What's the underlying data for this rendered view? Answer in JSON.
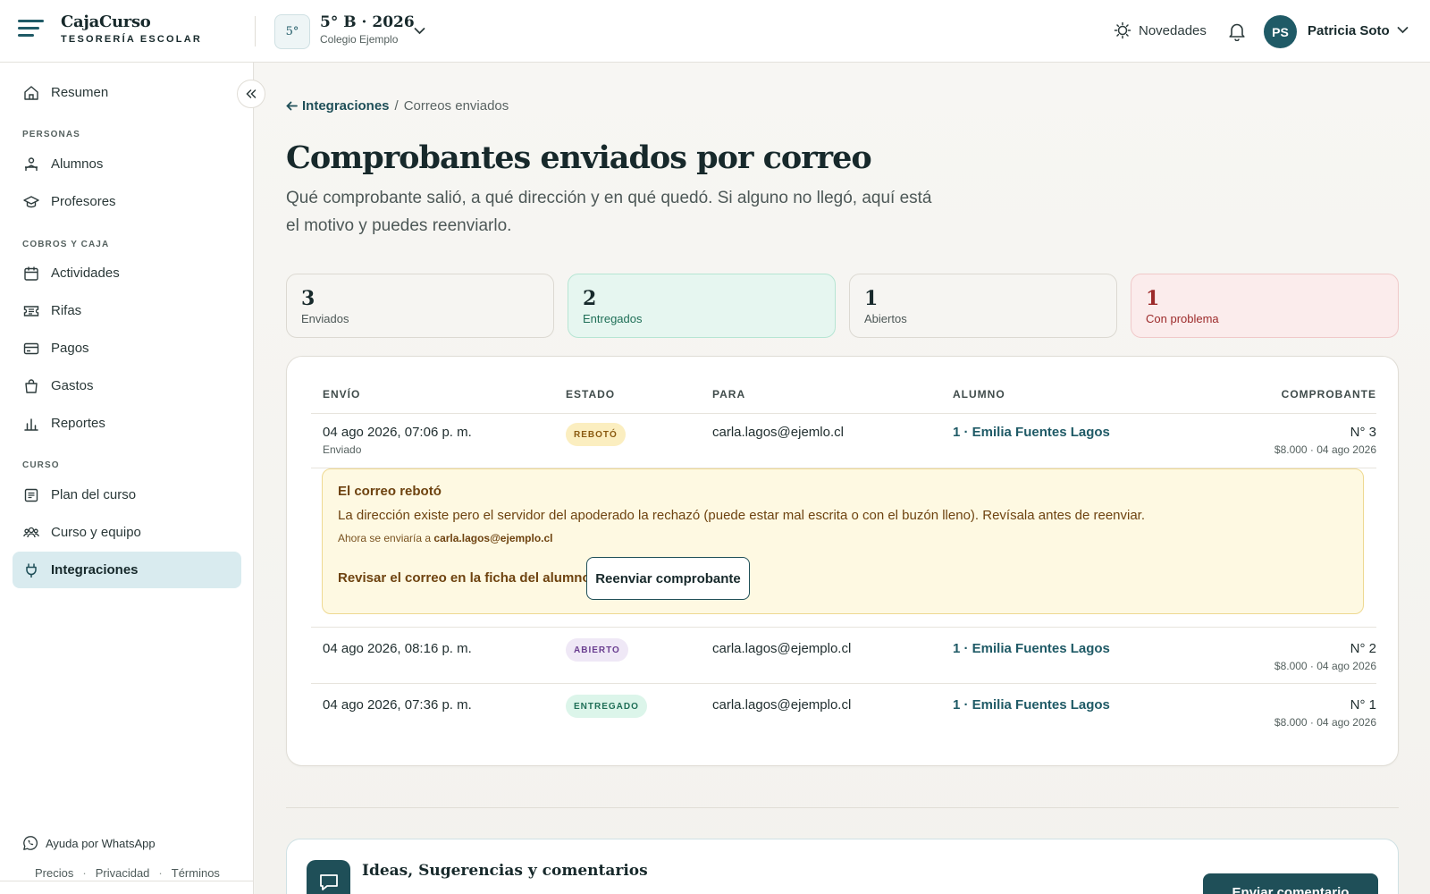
{
  "header": {
    "brand_name": "CajaCurso",
    "brand_sub": "TESORERÍA ESCOLAR",
    "course_badge": "5°",
    "course_title": "5° B · 2026",
    "course_school": "Colegio Ejemplo",
    "news_label": "Novedades",
    "user_initials": "PS",
    "user_name": "Patricia Soto"
  },
  "sidebar": {
    "summary": "Resumen",
    "section_people": "PERSONAS",
    "students": "Alumnos",
    "teachers": "Profesores",
    "section_billing": "COBROS Y CAJA",
    "activities": "Actividades",
    "raffles": "Rifas",
    "payments": "Pagos",
    "expenses": "Gastos",
    "reports": "Reportes",
    "section_course": "CURSO",
    "plan": "Plan del curso",
    "team": "Curso y equipo",
    "integrations": "Integraciones",
    "whatsapp": "Ayuda por WhatsApp",
    "footer": [
      "Precios",
      "Privacidad",
      "Términos"
    ]
  },
  "breadcrumb": {
    "back_label": "Integraciones",
    "separator": "/",
    "current": "Correos enviados"
  },
  "page": {
    "title": "Comprobantes enviados por correo",
    "description": "Qué comprobante salió, a qué dirección y en qué quedó. Si alguno no llegó, aquí está el motivo y puedes reenviarlo."
  },
  "stats": [
    {
      "value": "3",
      "label": "Enviados"
    },
    {
      "value": "2",
      "label": "Entregados"
    },
    {
      "value": "1",
      "label": "Abiertos"
    },
    {
      "value": "1",
      "label": "Con problema"
    }
  ],
  "table": {
    "columns": [
      "ENVÍO",
      "ESTADO",
      "PARA",
      "ALUMNO",
      "COMPROBANTE"
    ],
    "rows": [
      {
        "sent": "04 ago 2026, 07:06 p. m.",
        "sent_sub": "Enviado",
        "status": "REBOTÓ",
        "to": "carla.lagos@ejemlo.cl",
        "student": "1 · Emilia Fuentes Lagos",
        "receipt": "N° 3",
        "receipt_sub": "$8.000 · 04 ago 2026"
      },
      {
        "sent": "04 ago 2026, 08:16 p. m.",
        "status": "ABIERTO",
        "to": "carla.lagos@ejemplo.cl",
        "student": "1 · Emilia Fuentes Lagos",
        "receipt": "N° 2",
        "receipt_sub": "$8.000 · 04 ago 2026"
      },
      {
        "sent": "04 ago 2026, 07:36 p. m.",
        "status": "ENTREGADO",
        "to": "carla.lagos@ejemplo.cl",
        "student": "1 · Emilia Fuentes Lagos",
        "receipt": "N° 1",
        "receipt_sub": "$8.000 · 04 ago 2026"
      }
    ]
  },
  "alert": {
    "title": "El correo rebotó",
    "text": "La dirección existe pero el servidor del apoderado la rechazó (puede estar mal escrita o con el buzón lleno). Revísala antes de reenviar.",
    "resend_prefix": "Ahora se enviaría a",
    "resend_email": "carla.lagos@ejemplo.cl",
    "link_label": "Revisar el correo en la ficha del alumno",
    "button_label": "Reenviar comprobante"
  },
  "feedback": {
    "title": "Ideas, Sugerencias y comentarios",
    "button_label": "Enviar comentario"
  },
  "colors": {
    "accent": "#1f5a66",
    "success": "#1f6f57",
    "danger": "#9c2a2a",
    "warning": "#8a5a10"
  }
}
